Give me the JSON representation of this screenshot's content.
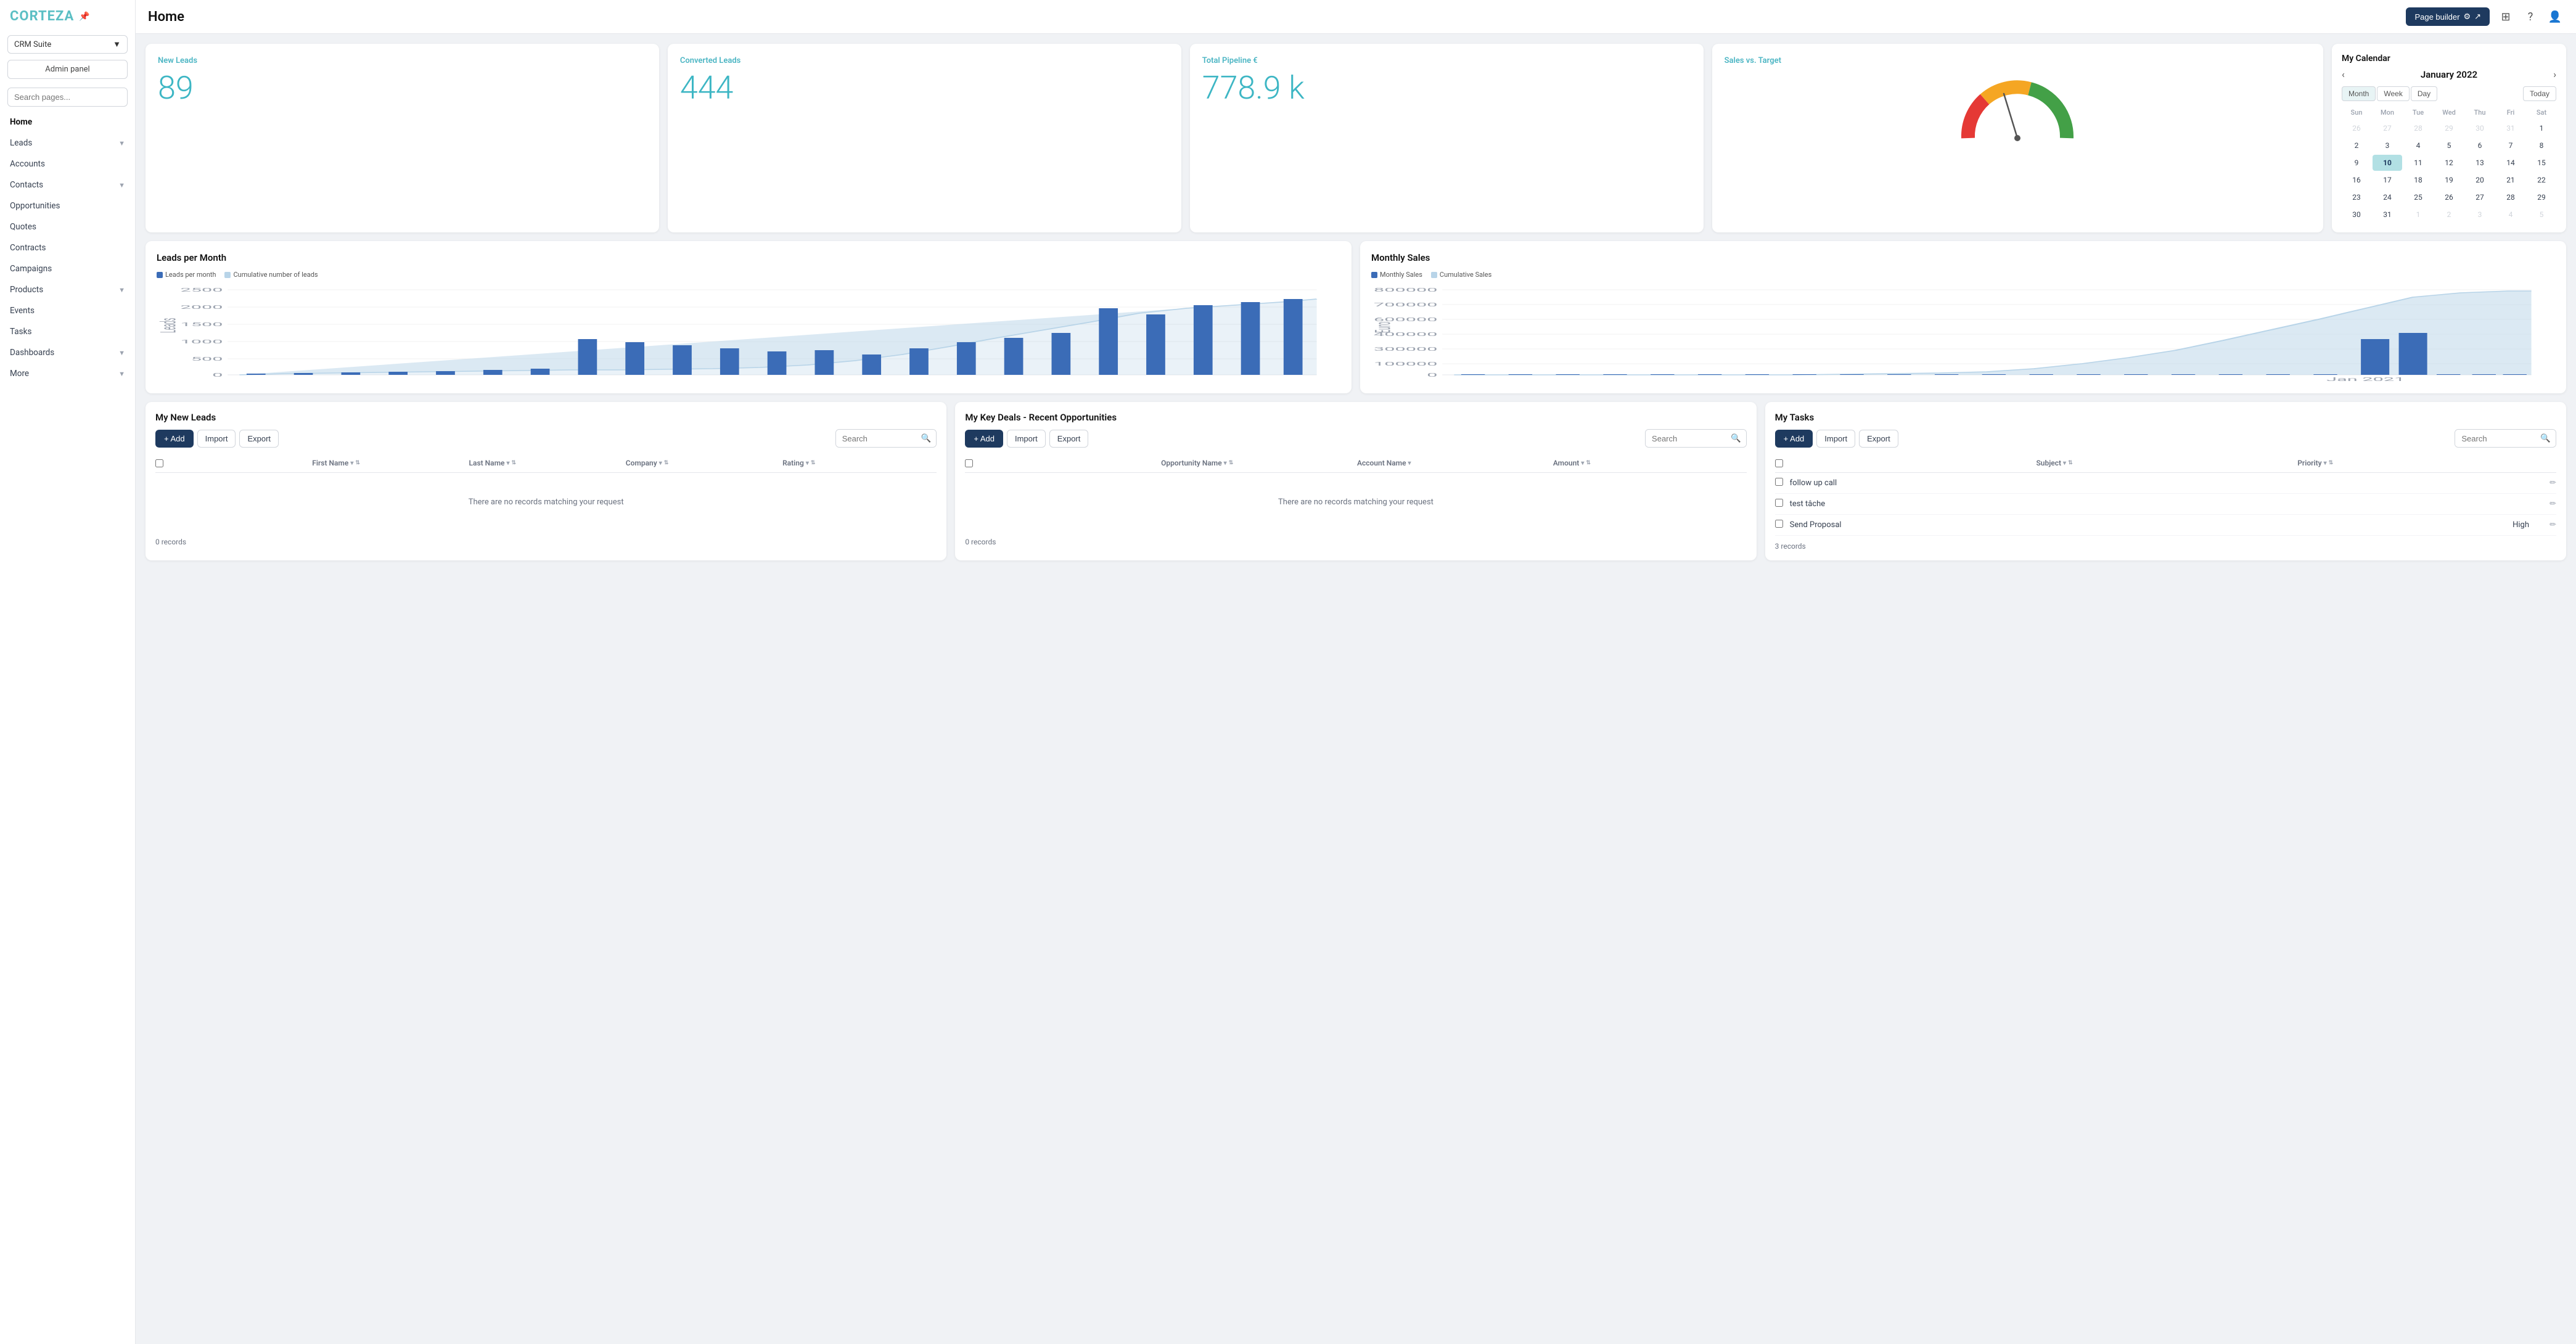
{
  "app": {
    "name": "CORTEZA",
    "pin_icon": "📌",
    "suite": "CRM Suite"
  },
  "topbar": {
    "title": "Home",
    "page_builder_label": "Page builder",
    "grid_icon": "⊞",
    "help_icon": "?",
    "user_icon": "👤"
  },
  "sidebar": {
    "search_placeholder": "Search pages...",
    "admin_panel_label": "Admin panel",
    "nav_items": [
      {
        "label": "Home",
        "active": true,
        "has_children": false
      },
      {
        "label": "Leads",
        "active": false,
        "has_children": true
      },
      {
        "label": "Accounts",
        "active": false,
        "has_children": false
      },
      {
        "label": "Contacts",
        "active": false,
        "has_children": true
      },
      {
        "label": "Opportunities",
        "active": false,
        "has_children": false
      },
      {
        "label": "Quotes",
        "active": false,
        "has_children": false
      },
      {
        "label": "Contracts",
        "active": false,
        "has_children": false
      },
      {
        "label": "Campaigns",
        "active": false,
        "has_children": false
      },
      {
        "label": "Products",
        "active": false,
        "has_children": true
      },
      {
        "label": "Events",
        "active": false,
        "has_children": false
      },
      {
        "label": "Tasks",
        "active": false,
        "has_children": false
      },
      {
        "label": "Dashboards",
        "active": false,
        "has_children": true
      },
      {
        "label": "More",
        "active": false,
        "has_children": true
      }
    ]
  },
  "stats": {
    "new_leads": {
      "label": "New Leads",
      "value": "89"
    },
    "converted_leads": {
      "label": "Converted Leads",
      "value": "444"
    },
    "total_pipeline": {
      "label": "Total Pipeline €",
      "value": "778.9 k"
    },
    "sales_target": {
      "label": "Sales vs. Target"
    }
  },
  "leads_chart": {
    "title": "Leads per Month",
    "legend": [
      {
        "label": "Leads per month",
        "color": "#3b6cb7"
      },
      {
        "label": "Cumulative number of leads",
        "color": "#b8d4e8"
      }
    ]
  },
  "monthly_sales_chart": {
    "title": "Monthly Sales",
    "legend": [
      {
        "label": "Monthly Sales",
        "color": "#3b6cb7"
      },
      {
        "label": "Cumulative Sales",
        "color": "#b8d4e8"
      }
    ]
  },
  "calendar": {
    "title": "My Calendar",
    "month_year": "January 2022",
    "view_btns": [
      "Month",
      "Week",
      "Day"
    ],
    "active_view": "Month",
    "today_label": "Today",
    "days_of_week": [
      "Sun",
      "Mon",
      "Tue",
      "Wed",
      "Thu",
      "Fri",
      "Sat"
    ],
    "today_date": 10,
    "weeks": [
      [
        {
          "day": 26,
          "other": true
        },
        {
          "day": 27,
          "other": true
        },
        {
          "day": 28,
          "other": true
        },
        {
          "day": 29,
          "other": true
        },
        {
          "day": 30,
          "other": true
        },
        {
          "day": 31,
          "other": true
        },
        {
          "day": 1,
          "other": false
        }
      ],
      [
        {
          "day": 2,
          "other": false
        },
        {
          "day": 3,
          "other": false
        },
        {
          "day": 4,
          "other": false
        },
        {
          "day": 5,
          "other": false
        },
        {
          "day": 6,
          "other": false
        },
        {
          "day": 7,
          "other": false
        },
        {
          "day": 8,
          "other": false
        }
      ],
      [
        {
          "day": 9,
          "other": false
        },
        {
          "day": 10,
          "other": false,
          "today": true
        },
        {
          "day": 11,
          "other": false
        },
        {
          "day": 12,
          "other": false
        },
        {
          "day": 13,
          "other": false
        },
        {
          "day": 14,
          "other": false
        },
        {
          "day": 15,
          "other": false
        }
      ],
      [
        {
          "day": 16,
          "other": false
        },
        {
          "day": 17,
          "other": false
        },
        {
          "day": 18,
          "other": false
        },
        {
          "day": 19,
          "other": false
        },
        {
          "day": 20,
          "other": false
        },
        {
          "day": 21,
          "other": false
        },
        {
          "day": 22,
          "other": false
        }
      ],
      [
        {
          "day": 23,
          "other": false
        },
        {
          "day": 24,
          "other": false
        },
        {
          "day": 25,
          "other": false
        },
        {
          "day": 26,
          "other": false
        },
        {
          "day": 27,
          "other": false
        },
        {
          "day": 28,
          "other": false
        },
        {
          "day": 29,
          "other": false
        }
      ],
      [
        {
          "day": 30,
          "other": false
        },
        {
          "day": 31,
          "other": false
        },
        {
          "day": 1,
          "other": true
        },
        {
          "day": 2,
          "other": true
        },
        {
          "day": 3,
          "other": true
        },
        {
          "day": 4,
          "other": true
        },
        {
          "day": 5,
          "other": true
        }
      ]
    ]
  },
  "my_new_leads": {
    "title": "My New Leads",
    "add_label": "+ Add",
    "import_label": "Import",
    "export_label": "Export",
    "search_placeholder": "Search",
    "columns": [
      "First Name",
      "Last Name",
      "Company",
      "Rating"
    ],
    "no_records_msg": "There are no records matching your request",
    "records_count": "0 records"
  },
  "my_key_deals": {
    "title": "My Key Deals - Recent Opportunities",
    "add_label": "+ Add",
    "import_label": "Import",
    "export_label": "Export",
    "search_placeholder": "Search",
    "columns": [
      "Opportunity Name",
      "Account Name",
      "Amount"
    ],
    "no_records_msg": "There are no records matching your request",
    "records_count": "0 records"
  },
  "my_tasks": {
    "title": "My Tasks",
    "add_label": "+ Add",
    "import_label": "Import",
    "export_label": "Export",
    "search_placeholder": "Search",
    "columns": [
      "Subject",
      "Priority"
    ],
    "tasks": [
      {
        "name": "follow up call",
        "priority": ""
      },
      {
        "name": "test tâche",
        "priority": ""
      },
      {
        "name": "Send Proposal",
        "priority": "High"
      }
    ],
    "records_count": "3 records"
  },
  "colors": {
    "accent": "#3db6c4",
    "dark_blue": "#1e3a5f",
    "light_blue": "#b8d4e8",
    "mid_blue": "#3b6cb7"
  }
}
